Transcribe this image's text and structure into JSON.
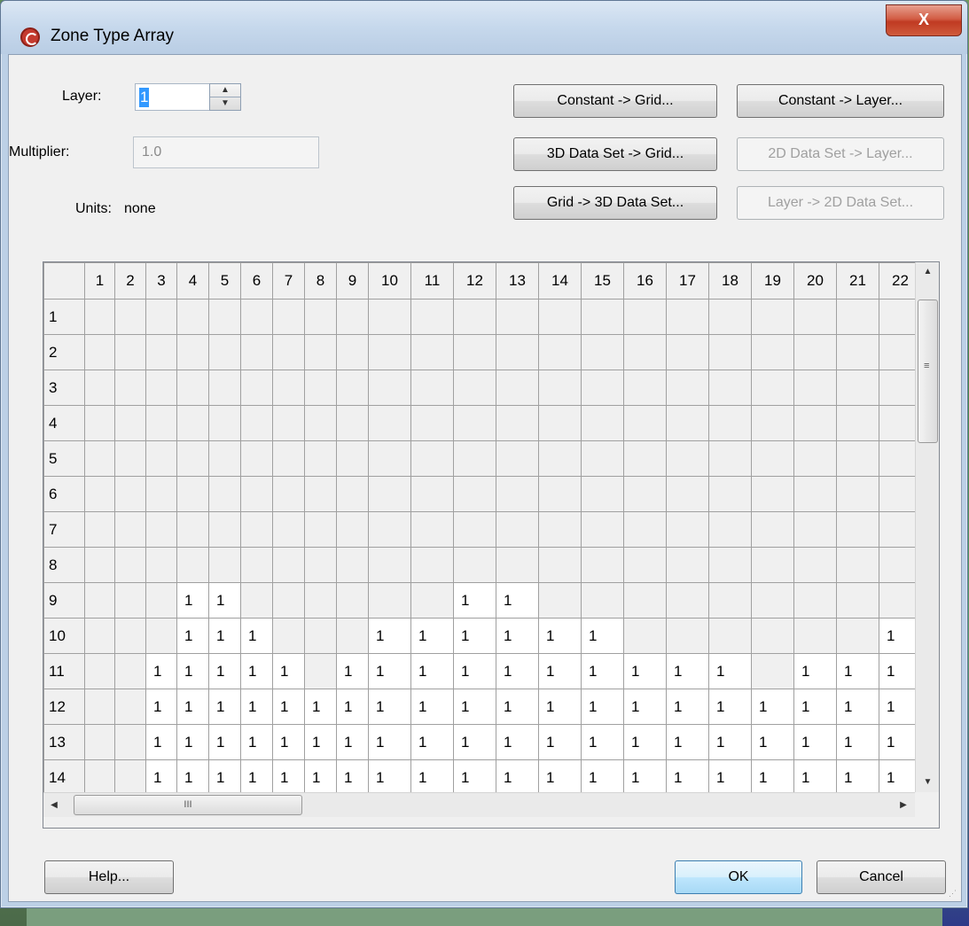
{
  "window": {
    "title": "Zone Type Array",
    "close_glyph": "X",
    "app_icon": "gms-logo-icon"
  },
  "form": {
    "layer_label": "Layer:",
    "layer_value": "1",
    "multiplier_label": "Multiplier:",
    "multiplier_value": "1.0",
    "units_label": "Units:",
    "units_value": "none"
  },
  "buttons": {
    "constant_grid": "Constant -> Grid...",
    "constant_layer": "Constant -> Layer...",
    "dataset3d_grid": "3D Data Set -> Grid...",
    "dataset2d_layer": "2D Data Set -> Layer...",
    "grid_dataset3d": "Grid -> 3D Data Set...",
    "layer_dataset2d": "Layer -> 2D Data Set...",
    "help": "Help...",
    "ok": "OK",
    "cancel": "Cancel"
  },
  "grid": {
    "columns": [
      "1",
      "2",
      "3",
      "4",
      "5",
      "6",
      "7",
      "8",
      "9",
      "10",
      "11",
      "12",
      "13",
      "14",
      "15",
      "16",
      "17",
      "18",
      "19",
      "20",
      "21",
      "22"
    ],
    "rows": [
      {
        "label": "1",
        "cells": [
          "",
          "",
          "",
          "",
          "",
          "",
          "",
          "",
          "",
          "",
          "",
          "",
          "",
          "",
          "",
          "",
          "",
          "",
          "",
          "",
          "",
          ""
        ]
      },
      {
        "label": "2",
        "cells": [
          "",
          "",
          "",
          "",
          "",
          "",
          "",
          "",
          "",
          "",
          "",
          "",
          "",
          "",
          "",
          "",
          "",
          "",
          "",
          "",
          "",
          ""
        ]
      },
      {
        "label": "3",
        "cells": [
          "",
          "",
          "",
          "",
          "",
          "",
          "",
          "",
          "",
          "",
          "",
          "",
          "",
          "",
          "",
          "",
          "",
          "",
          "",
          "",
          "",
          ""
        ]
      },
      {
        "label": "4",
        "cells": [
          "",
          "",
          "",
          "",
          "",
          "",
          "",
          "",
          "",
          "",
          "",
          "",
          "",
          "",
          "",
          "",
          "",
          "",
          "",
          "",
          "",
          ""
        ]
      },
      {
        "label": "5",
        "cells": [
          "",
          "",
          "",
          "",
          "",
          "",
          "",
          "",
          "",
          "",
          "",
          "",
          "",
          "",
          "",
          "",
          "",
          "",
          "",
          "",
          "",
          ""
        ]
      },
      {
        "label": "6",
        "cells": [
          "",
          "",
          "",
          "",
          "",
          "",
          "",
          "",
          "",
          "",
          "",
          "",
          "",
          "",
          "",
          "",
          "",
          "",
          "",
          "",
          "",
          ""
        ]
      },
      {
        "label": "7",
        "cells": [
          "",
          "",
          "",
          "",
          "",
          "",
          "",
          "",
          "",
          "",
          "",
          "",
          "",
          "",
          "",
          "",
          "",
          "",
          "",
          "",
          "",
          ""
        ]
      },
      {
        "label": "8",
        "cells": [
          "",
          "",
          "",
          "",
          "",
          "",
          "",
          "",
          "",
          "",
          "",
          "",
          "",
          "",
          "",
          "",
          "",
          "",
          "",
          "",
          "",
          ""
        ]
      },
      {
        "label": "9",
        "cells": [
          "",
          "",
          "",
          "1",
          "1",
          "",
          "",
          "",
          "",
          "",
          "",
          "1",
          "1",
          "",
          "",
          "",
          "",
          "",
          "",
          "",
          "",
          ""
        ]
      },
      {
        "label": "10",
        "cells": [
          "",
          "",
          "",
          "1",
          "1",
          "1",
          "",
          "",
          "",
          "1",
          "1",
          "1",
          "1",
          "1",
          "1",
          "",
          "",
          "",
          "",
          "",
          "",
          "1"
        ]
      },
      {
        "label": "11",
        "cells": [
          "",
          "",
          "1",
          "1",
          "1",
          "1",
          "1",
          "",
          "1",
          "1",
          "1",
          "1",
          "1",
          "1",
          "1",
          "1",
          "1",
          "1",
          "",
          "1",
          "1",
          "1"
        ]
      },
      {
        "label": "12",
        "cells": [
          "",
          "",
          "1",
          "1",
          "1",
          "1",
          "1",
          "1",
          "1",
          "1",
          "1",
          "1",
          "1",
          "1",
          "1",
          "1",
          "1",
          "1",
          "1",
          "1",
          "1",
          "1"
        ]
      },
      {
        "label": "13",
        "cells": [
          "",
          "",
          "1",
          "1",
          "1",
          "1",
          "1",
          "1",
          "1",
          "1",
          "1",
          "1",
          "1",
          "1",
          "1",
          "1",
          "1",
          "1",
          "1",
          "1",
          "1",
          "1"
        ]
      },
      {
        "label": "14",
        "cells": [
          "",
          "",
          "1",
          "1",
          "1",
          "1",
          "1",
          "1",
          "1",
          "1",
          "1",
          "1",
          "1",
          "1",
          "1",
          "1",
          "1",
          "1",
          "1",
          "1",
          "1",
          "1"
        ]
      }
    ]
  },
  "scrollbars": {
    "v_up": "▲",
    "v_down": "▼",
    "v_grip": "≡",
    "h_left": "◀",
    "h_right": "▶",
    "h_grip": "III"
  }
}
